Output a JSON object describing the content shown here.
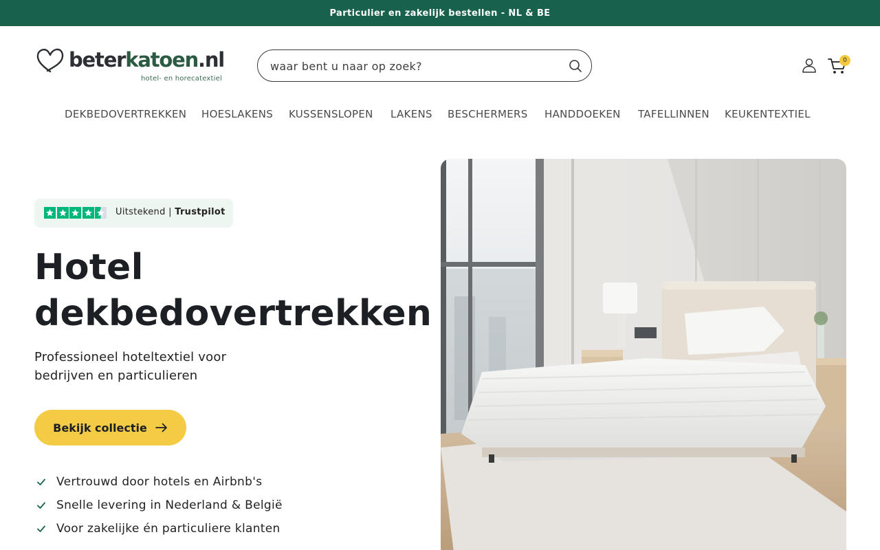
{
  "announcement": {
    "text": "Particulier en zakelijk bestellen - NL & BE"
  },
  "logo": {
    "word_dark": "beter",
    "word_green": "katoen",
    "word_suffix": ".nl",
    "tagline": "hotel- en horecatextiel"
  },
  "search": {
    "placeholder": "waar bent u naar op zoek?",
    "value": ""
  },
  "header": {
    "cart_count": "0"
  },
  "nav": {
    "items": [
      {
        "label": "DEKBEDOVERTREKKEN"
      },
      {
        "label": "HOESLAKENS"
      },
      {
        "label": "KUSSENSLOPEN"
      },
      {
        "label": "LAKENS"
      },
      {
        "label": "BESCHERMERS"
      },
      {
        "label": "HANDDOEKEN"
      },
      {
        "label": "TAFELLINNEN"
      },
      {
        "label": "KEUKENTEXTIEL"
      }
    ]
  },
  "trust": {
    "rating_stars": 4.5,
    "label": "Uitstekend |",
    "brand": "Trustpilot"
  },
  "hero": {
    "title_line1": "Hotel",
    "title_line2": "dekbedovertrekken",
    "subtitle": "Professioneel hoteltextiel voor bedrijven en particulieren",
    "cta_label": "Bekijk collectie",
    "usps": [
      {
        "text": "Vertrouwd door hotels en Airbnb's"
      },
      {
        "text": "Snelle levering in Nederland & België"
      },
      {
        "text": "Voor zakelijke én particuliere klanten"
      }
    ]
  },
  "colors": {
    "brand_green": "#17614d",
    "accent_yellow": "#f3cb45",
    "trustpilot_green": "#00b67a"
  }
}
